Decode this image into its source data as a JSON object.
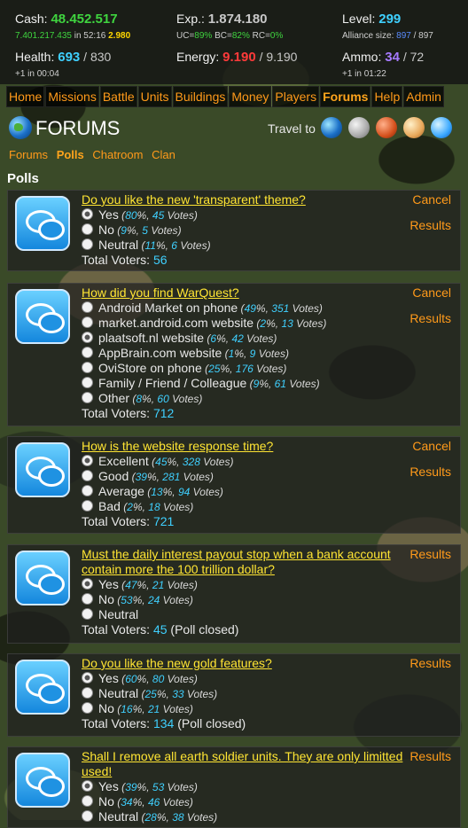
{
  "stats": {
    "cash_label": "Cash:",
    "cash": "48.452.517",
    "cash_rate": "7.401.217.435",
    "cash_in": "in 52:16",
    "cash_extra": "2.980",
    "exp_label": "Exp.:",
    "exp": "1.874.180",
    "uc_label": "UC=",
    "uc": "89%",
    "bc_label": "BC=",
    "bc": "82%",
    "rc_label": "RC=",
    "rc": "0%",
    "level_label": "Level:",
    "level": "299",
    "alliance_label": "Alliance size:",
    "alliance": "897",
    "alliance_max": "/ 897",
    "health_label": "Health:",
    "health": "693",
    "health_max": "/ 830",
    "health_sub": "+1 in 00:04",
    "energy_label": "Energy:",
    "energy": "9.190",
    "energy_max": "/ 9.190",
    "ammo_label": "Ammo:",
    "ammo": "34",
    "ammo_max": "/ 72",
    "ammo_sub": "+1 in 01:22"
  },
  "menu": [
    "Home",
    "Missions",
    "Battle",
    "Units",
    "Buildings",
    "Money",
    "Players",
    "Forums",
    "Help",
    "Admin"
  ],
  "menu_active": "Forums",
  "header": {
    "title": "FORUMS",
    "travel": "Travel to"
  },
  "subnav": [
    "Forums",
    "Polls",
    "Chatroom",
    "Clan"
  ],
  "subnav_active": "Polls",
  "section_title": "Polls",
  "poll_labels": {
    "cancel": "Cancel",
    "results": "Results",
    "total": "Total Voters:",
    "closed": "(Poll closed)",
    "votes": "Votes"
  },
  "polls": [
    {
      "question": "Do you like the new 'transparent' theme?",
      "options": [
        {
          "label": "Yes",
          "pct": "80",
          "votes": "45",
          "selected": true
        },
        {
          "label": "No",
          "pct": "9",
          "votes": "5"
        },
        {
          "label": "Neutral",
          "pct": "11",
          "votes": "6"
        }
      ],
      "total": "56"
    },
    {
      "question": "How did you find WarQuest?",
      "options": [
        {
          "label": "Android Market on phone",
          "pct": "49",
          "votes": "351"
        },
        {
          "label": "market.android.com website",
          "pct": "2",
          "votes": "13"
        },
        {
          "label": "plaatsoft.nl website",
          "pct": "6",
          "votes": "42",
          "selected": true
        },
        {
          "label": "AppBrain.com website",
          "pct": "1",
          "votes": "9"
        },
        {
          "label": "OviStore on phone",
          "pct": "25",
          "votes": "176"
        },
        {
          "label": "Family / Friend / Colleague",
          "pct": "9",
          "votes": "61"
        },
        {
          "label": "Other",
          "pct": "8",
          "votes": "60"
        }
      ],
      "total": "712"
    },
    {
      "question": "How is the website response time?",
      "options": [
        {
          "label": "Excellent",
          "pct": "45",
          "votes": "328",
          "selected": true
        },
        {
          "label": "Good",
          "pct": "39",
          "votes": "281"
        },
        {
          "label": "Average",
          "pct": "13",
          "votes": "94"
        },
        {
          "label": "Bad",
          "pct": "2",
          "votes": "18"
        }
      ],
      "total": "721"
    },
    {
      "question": "Must the daily interest payout stop when a bank account contain more the 100 trillion dollar?",
      "options": [
        {
          "label": "Yes",
          "pct": "47",
          "votes": "21",
          "selected": true
        },
        {
          "label": "No",
          "pct": "53",
          "votes": "24"
        },
        {
          "label": "Neutral"
        }
      ],
      "total": "45",
      "closed": true
    },
    {
      "question": "Do you like the new gold features?",
      "options": [
        {
          "label": "Yes",
          "pct": "60",
          "votes": "80",
          "selected": true
        },
        {
          "label": "Neutral",
          "pct": "25",
          "votes": "33"
        },
        {
          "label": "No",
          "pct": "16",
          "votes": "21"
        }
      ],
      "total": "134",
      "closed": true
    },
    {
      "question": "Shall I remove all earth soldier units. They are only limitted used!",
      "options": [
        {
          "label": "Yes",
          "pct": "39",
          "votes": "53",
          "selected": true
        },
        {
          "label": "No",
          "pct": "34",
          "votes": "46"
        },
        {
          "label": "Neutral",
          "pct": "28",
          "votes": "38"
        }
      ],
      "total": ""
    }
  ]
}
